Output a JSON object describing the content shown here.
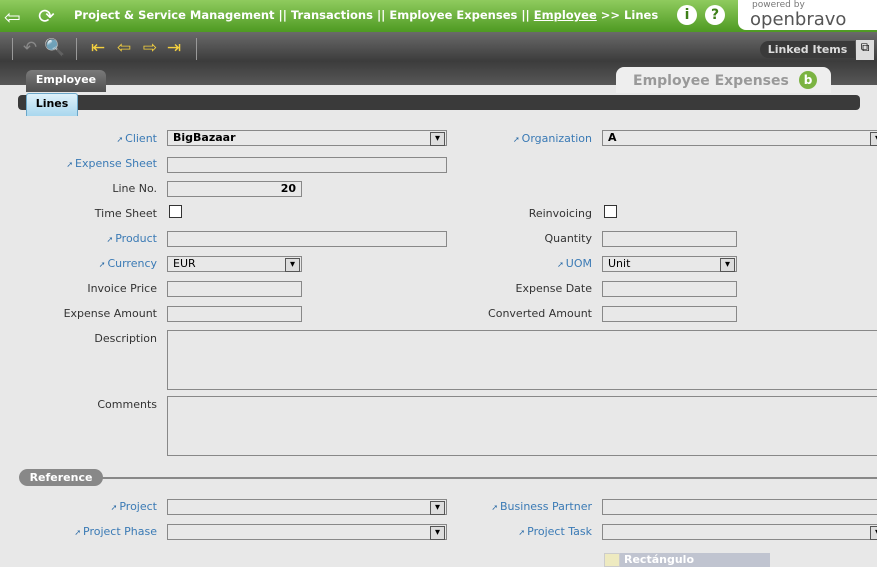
{
  "header": {
    "crumbs": "Project & Service Management || Transactions || Employee Expenses || ",
    "link": "Employee",
    "tail": " >> Lines",
    "powered": "powered by",
    "logo": "openbravo"
  },
  "toolbar": {
    "linked_items": "Linked Items"
  },
  "tabs": {
    "parent": "Employee",
    "current": "Lines",
    "window_title": "Employee Expenses"
  },
  "form": {
    "client": {
      "label": "Client",
      "value": "BigBazaar"
    },
    "organization": {
      "label": "Organization",
      "value": "A"
    },
    "expense_sheet": {
      "label": "Expense Sheet",
      "value": ""
    },
    "line_no": {
      "label": "Line No.",
      "value": "20"
    },
    "time_sheet": {
      "label": "Time Sheet"
    },
    "reinvoicing": {
      "label": "Reinvoicing"
    },
    "product": {
      "label": "Product",
      "value": ""
    },
    "quantity": {
      "label": "Quantity",
      "value": ""
    },
    "currency": {
      "label": "Currency",
      "value": "EUR"
    },
    "uom": {
      "label": "UOM",
      "value": "Unit"
    },
    "invoice_price": {
      "label": "Invoice Price",
      "value": ""
    },
    "expense_date": {
      "label": "Expense Date",
      "value": ""
    },
    "expense_amount": {
      "label": "Expense Amount",
      "value": ""
    },
    "converted_amount": {
      "label": "Converted Amount",
      "value": ""
    },
    "description": {
      "label": "Description"
    },
    "comments": {
      "label": "Comments"
    }
  },
  "reference": {
    "title": "Reference",
    "project": "Project",
    "business_partner": "Business Partner",
    "project_phase": "Project Phase",
    "project_task": "Project Task",
    "clipped": "Rectángulo"
  }
}
